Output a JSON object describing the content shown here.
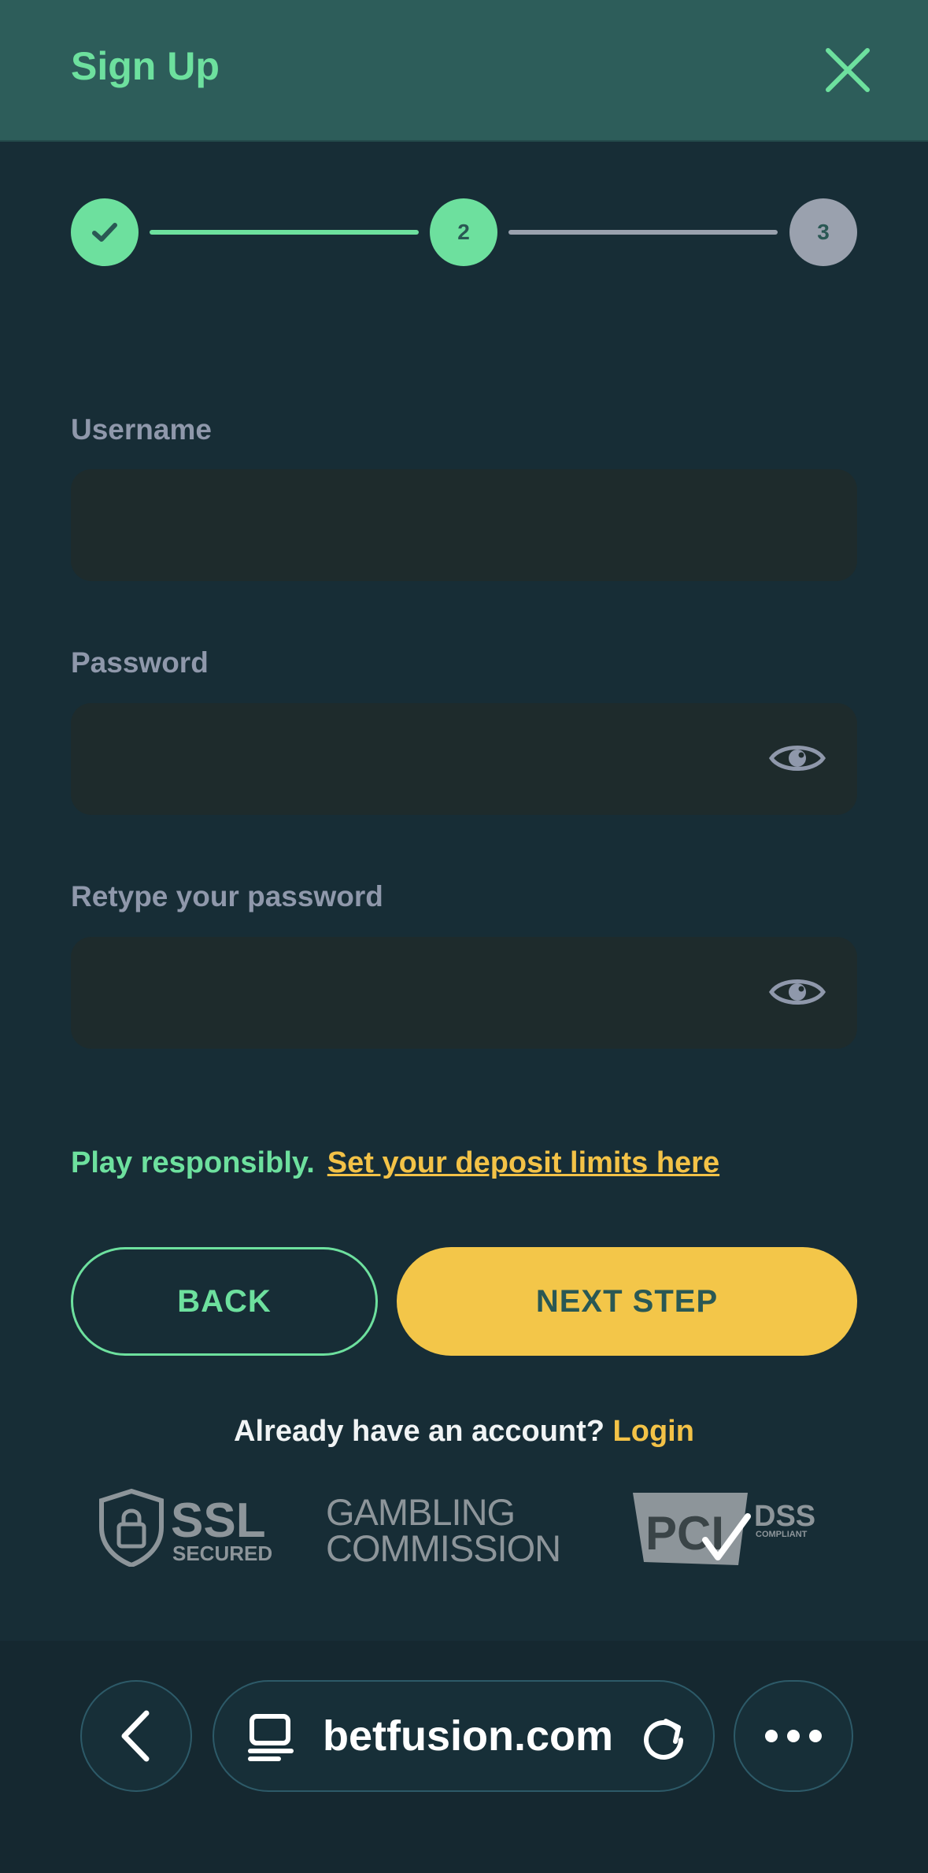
{
  "header": {
    "title": "Sign Up",
    "close_icon": "close-icon"
  },
  "stepper": {
    "steps": [
      {
        "label": "",
        "state": "completed",
        "icon": "check-icon"
      },
      {
        "label": "2",
        "state": "active"
      },
      {
        "label": "3",
        "state": "upcoming"
      }
    ],
    "colors": {
      "active": "#6de09e",
      "upcoming": "#9aa1ae"
    }
  },
  "form": {
    "username": {
      "label": "Username",
      "value": "",
      "placeholder": ""
    },
    "password": {
      "label": "Password",
      "value": "",
      "placeholder": "",
      "toggle_icon": "eye-icon"
    },
    "retype": {
      "label": "Retype your password",
      "value": "",
      "placeholder": "",
      "toggle_icon": "eye-icon"
    }
  },
  "responsible": {
    "text": "Play responsibly.",
    "link": "Set your deposit limits here"
  },
  "buttons": {
    "back": "BACK",
    "next": "NEXT STEP"
  },
  "account": {
    "prompt": "Already have an account?",
    "login": "Login"
  },
  "badges": {
    "ssl_main": "SSL",
    "ssl_sub": "SECURED",
    "gambling_line1": "GAMBLING",
    "gambling_line2": "COMMISSION",
    "pci_main": "PCI",
    "pci_dss": "DSS",
    "pci_sub": "COMPLIANT"
  },
  "browser": {
    "url": "betfusion.com"
  },
  "colors": {
    "accent_green": "#6de09e",
    "accent_yellow": "#f3c649",
    "background": "#172d36",
    "header_bg": "#2d5d5a"
  }
}
